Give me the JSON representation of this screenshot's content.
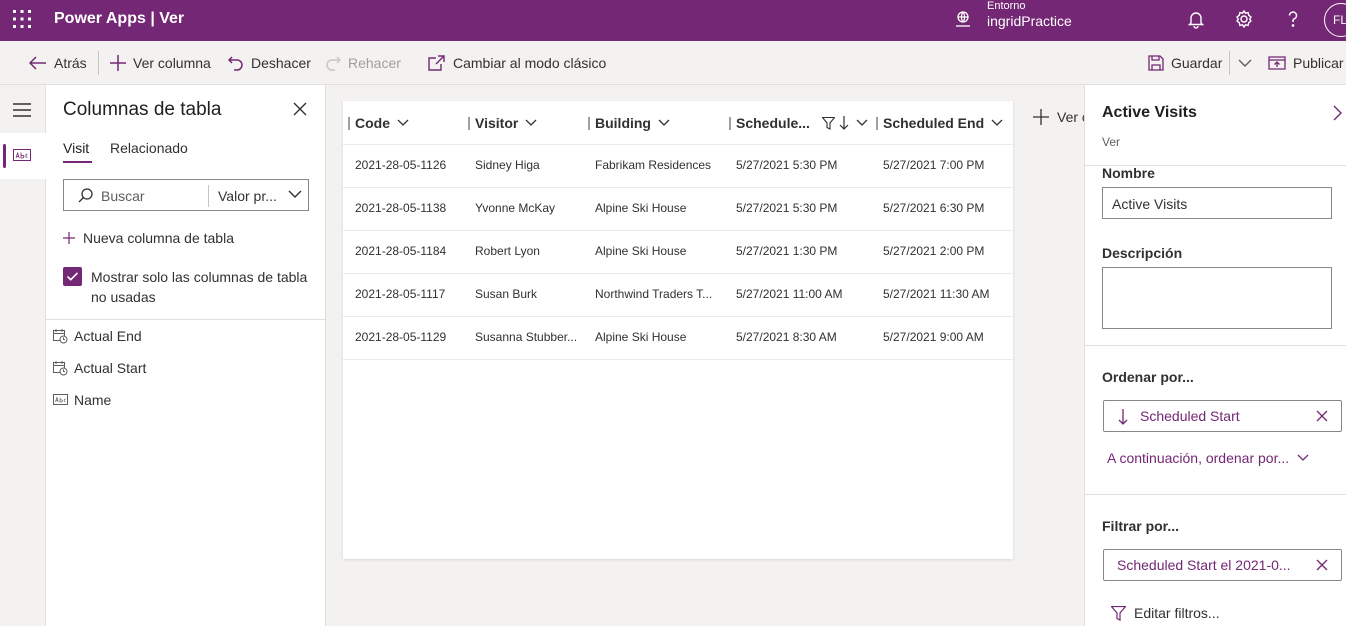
{
  "colors": {
    "brand": "#742774",
    "accent_text": "#742774"
  },
  "topbar": {
    "app_title": "Power Apps  |  Ver",
    "env_label": "Entorno",
    "env_name": "ingridPractice",
    "avatar_initials": "FL",
    "icons": [
      "waffle-icon",
      "environment-icon",
      "bell-icon",
      "gear-icon",
      "help-icon"
    ]
  },
  "commandbar": {
    "back": "Atrás",
    "add_column": "Ver columna",
    "undo": "Deshacer",
    "redo": "Rehacer",
    "classic": "Cambiar al modo clásico",
    "save": "Guardar",
    "publish": "Publicar"
  },
  "columns_panel": {
    "title": "Columnas de tabla",
    "tabs": [
      "Visit",
      "Relacionado"
    ],
    "active_tab": "Visit",
    "search_placeholder": "Buscar",
    "filter_value": "Valor pr...",
    "new_column": "Nueva columna de tabla",
    "show_unused_label": "Mostrar solo las columnas de tabla no usadas",
    "show_unused_checked": true,
    "fields": [
      {
        "label": "Actual End",
        "icon": "datetime-icon"
      },
      {
        "label": "Actual Start",
        "icon": "datetime-icon"
      },
      {
        "label": "Name",
        "icon": "text-field-icon"
      }
    ]
  },
  "grid": {
    "columns": [
      "Code",
      "Visitor",
      "Building",
      "Schedule...",
      "Scheduled End"
    ],
    "rows": [
      [
        "2021-28-05-1126",
        "Sidney Higa",
        "Fabrikam Residences",
        "5/27/2021 5:30 PM",
        "5/27/2021 7:00 PM"
      ],
      [
        "2021-28-05-1138",
        "Yvonne McKay",
        "Alpine Ski House",
        "5/27/2021 5:30 PM",
        "5/27/2021 6:30 PM"
      ],
      [
        "2021-28-05-1184",
        "Robert Lyon",
        "Alpine Ski House",
        "5/27/2021 1:30 PM",
        "5/27/2021 2:00 PM"
      ],
      [
        "2021-28-05-1117",
        "Susan Burk",
        "Northwind Traders T...",
        "5/27/2021 11:00 AM",
        "5/27/2021 11:30 AM"
      ],
      [
        "2021-28-05-1129",
        "Susanna Stubber...",
        "Alpine Ski House",
        "5/27/2021 8:30 AM",
        "5/27/2021 9:00 AM"
      ]
    ],
    "add_column_partial": "Ver c"
  },
  "properties": {
    "title": "Active Visits",
    "subtitle": "Ver",
    "name_label": "Nombre",
    "name_value": "Active Visits",
    "description_label": "Descripción",
    "description_value": "",
    "sort_label": "Ordenar por...",
    "sort_field": "Scheduled Start",
    "then_sort": "A continuación, ordenar por...",
    "filter_label": "Filtrar por...",
    "filter_value": "Scheduled Start el 2021-0...",
    "edit_filters": "Editar filtros..."
  }
}
